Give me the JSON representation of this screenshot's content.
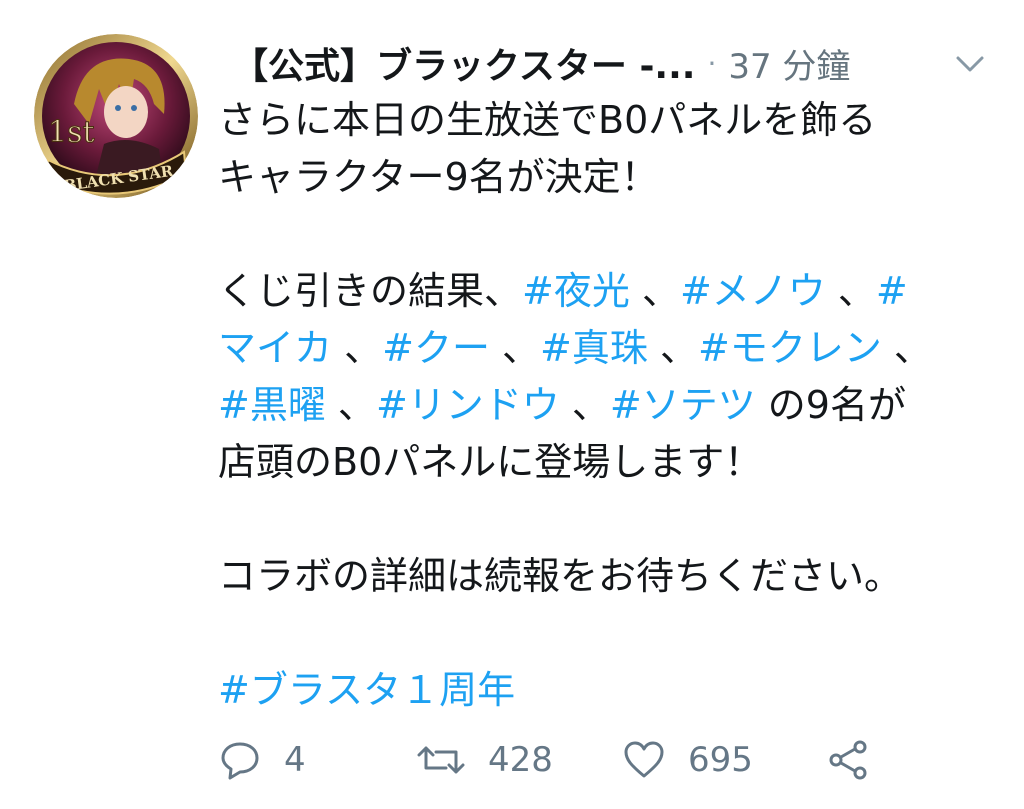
{
  "tweet": {
    "display_name": "【公式】ブラックスター -...",
    "separator": "·",
    "time": "37 分鐘",
    "avatar": {
      "badge_top": "1st",
      "badge_bottom": "BLACK STAR"
    },
    "body": {
      "line1": "さらに本日の生放送でB0パネルを飾る",
      "line2": "キャラクター9名が決定！",
      "line3_text": "くじ引きの結果、",
      "tag_yako": "#夜光",
      "sep_a": " 、",
      "tag_menou": "#メノウ",
      "sep_b": " 、",
      "tag_maika_a": "#",
      "tag_maika_b": "マイカ",
      "sep_c": " 、",
      "tag_ku": "#クー",
      "sep_d": " 、",
      "tag_shinju": "#真珠",
      "sep_e": " 、",
      "tag_mokuren": "#モクレン",
      "sep_f": " 、",
      "tag_kokuyou": "#黒曜",
      "sep_g": " 、",
      "tag_rindou": "#リンドウ",
      "sep_h": " 、",
      "tag_sotetsu": "#ソテツ",
      "line5_tail": " の9名が",
      "line6": "店頭のB0パネルに登場します！",
      "line8": "コラボの詳細は続報をお待ちください。",
      "tag_anniv": "#ブラスタ１周年"
    },
    "actions": {
      "reply_count": "4",
      "retweet_count": "428",
      "like_count": "695"
    },
    "colors": {
      "link": "#1da1f2",
      "meta": "#657786",
      "text": "#14171a"
    },
    "icons": [
      "caret-down-icon",
      "reply-icon",
      "retweet-icon",
      "like-icon",
      "share-icon"
    ]
  }
}
